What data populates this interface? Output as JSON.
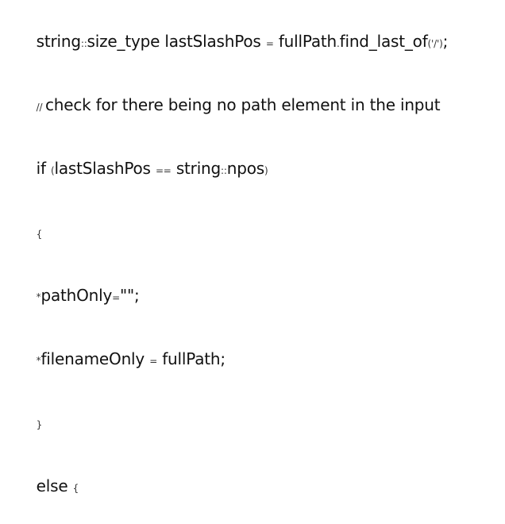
{
  "document": {
    "lines": [
      {
        "parts": [
          {
            "text": "string",
            "small": false
          },
          {
            "text": "::",
            "small": true
          },
          {
            "text": "size_type lastSlashPos ",
            "small": false
          },
          {
            "text": "=",
            "small": true
          },
          {
            "text": " fullPath",
            "small": false
          },
          {
            "text": ".",
            "small": true
          },
          {
            "text": "find_last_of",
            "small": false
          },
          {
            "text": "('/')",
            "small": true
          },
          {
            "text": ";",
            "small": false
          }
        ]
      },
      {
        "parts": [
          {
            "text": "// ",
            "small": true
          },
          {
            "text": "check for there being no path element in the input",
            "small": false
          }
        ]
      },
      {
        "parts": [
          {
            "text": "if ",
            "small": false
          },
          {
            "text": "(",
            "small": true
          },
          {
            "text": "lastSlashPos ",
            "small": false
          },
          {
            "text": "==",
            "small": true
          },
          {
            "text": " string",
            "small": false
          },
          {
            "text": "::",
            "small": true
          },
          {
            "text": "npos",
            "small": false
          },
          {
            "text": ")",
            "small": true
          }
        ]
      },
      {
        "parts": [
          {
            "text": "{",
            "small": true
          }
        ]
      },
      {
        "parts": [
          {
            "text": "*",
            "small": true
          },
          {
            "text": "pathOnly",
            "small": false
          },
          {
            "text": "=",
            "small": true
          },
          {
            "text": "\"\";",
            "small": false
          }
        ]
      },
      {
        "parts": [
          {
            "text": "*",
            "small": true
          },
          {
            "text": "filenameOnly ",
            "small": false
          },
          {
            "text": "=",
            "small": true
          },
          {
            "text": " fullPath;",
            "small": false
          }
        ]
      },
      {
        "parts": [
          {
            "text": "}",
            "small": true
          }
        ]
      },
      {
        "parts": [
          {
            "text": "else ",
            "small": false
          },
          {
            "text": "{",
            "small": true
          }
        ]
      }
    ]
  }
}
